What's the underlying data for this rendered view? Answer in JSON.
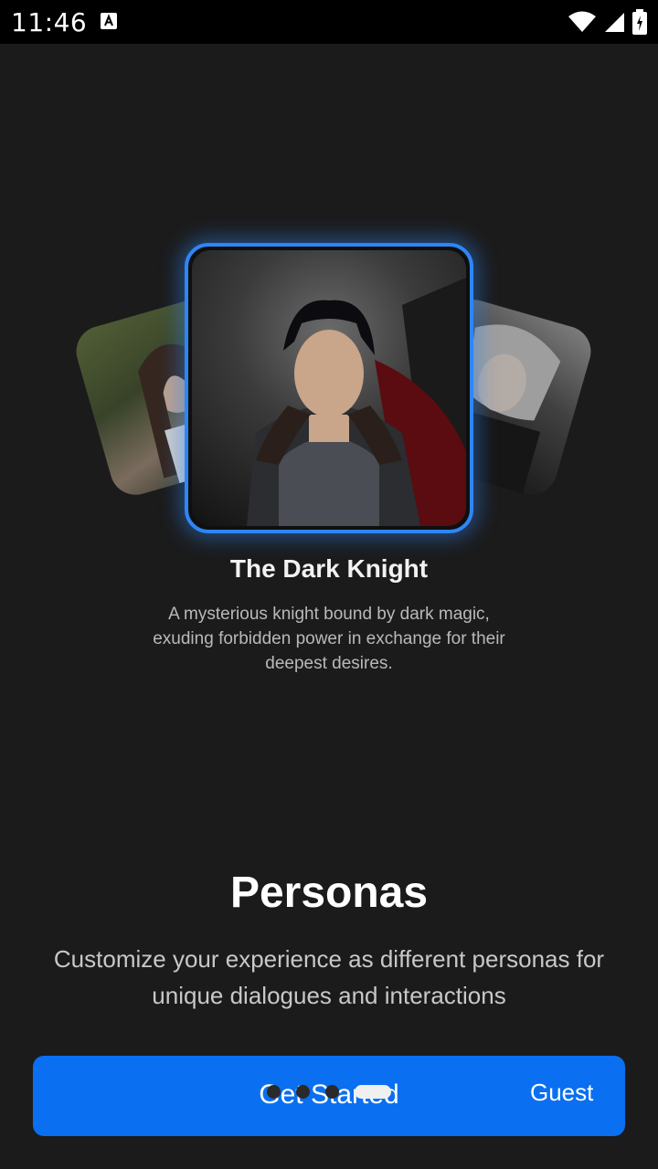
{
  "status_bar": {
    "time": "11:46"
  },
  "carousel": {
    "current": {
      "title": "The Dark Knight",
      "description": "A mysterious knight bound by dark magic, exuding forbidden power in exchange for their deepest desires."
    }
  },
  "section": {
    "title": "Personas",
    "description": "Customize your experience as different personas for unique dialogues and interactions"
  },
  "actions": {
    "get_started_label": "Get Started",
    "guest_label": "Guest"
  },
  "pagination": {
    "total": 4,
    "active_index": 3
  },
  "colors": {
    "accent": "#0a6ff0",
    "card_border": "#2e86f5",
    "background": "#1b1b1b"
  }
}
